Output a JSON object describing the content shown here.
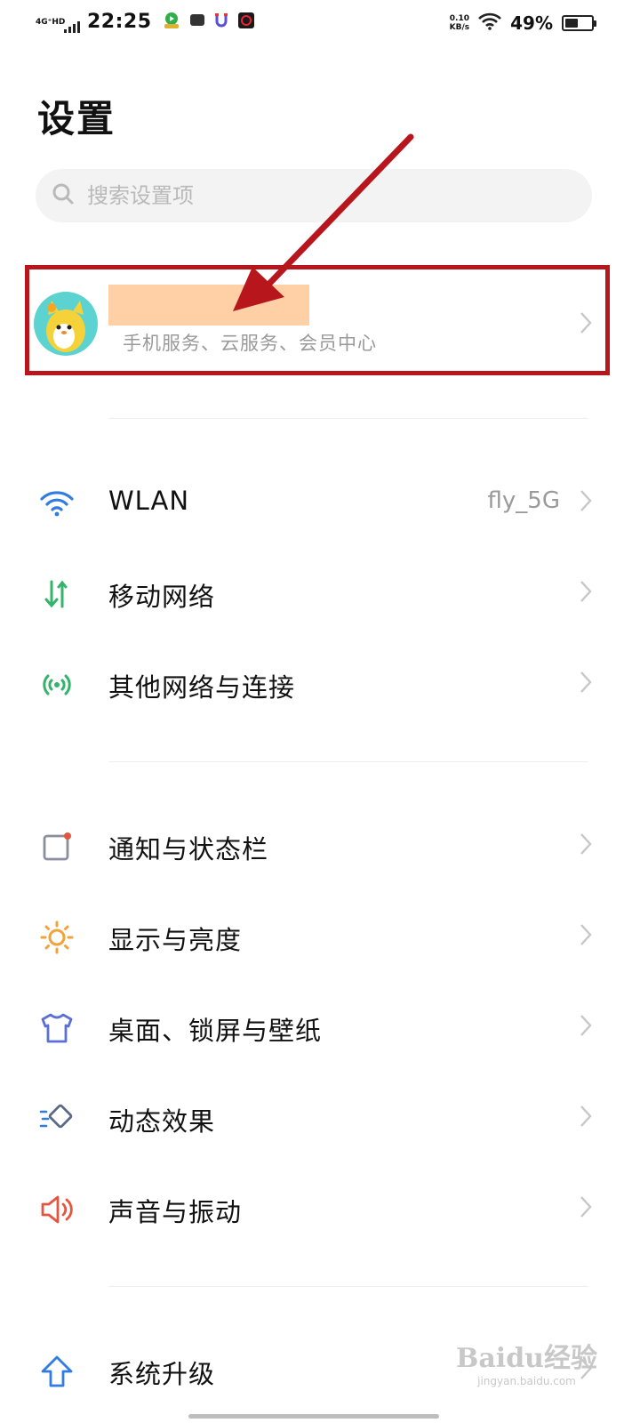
{
  "status_bar": {
    "network_type": "4G⁺HD",
    "time": "22:25",
    "speed_value": "0.10",
    "speed_unit": "KB/s",
    "battery_percent": "49%",
    "battery_level": 0.49
  },
  "page": {
    "title": "设置"
  },
  "search": {
    "placeholder": "搜索设置项"
  },
  "account": {
    "subtitle": "手机服务、云服务、会员中心"
  },
  "sections": [
    {
      "items": [
        {
          "label": "WLAN",
          "value": "fly_5G",
          "icon": "wifi-icon"
        },
        {
          "label": "移动网络",
          "icon": "mobile-network-icon"
        },
        {
          "label": "其他网络与连接",
          "icon": "connection-icon"
        }
      ]
    },
    {
      "items": [
        {
          "label": "通知与状态栏",
          "icon": "notification-icon"
        },
        {
          "label": "显示与亮度",
          "icon": "brightness-icon"
        },
        {
          "label": "桌面、锁屏与壁纸",
          "icon": "wallpaper-icon"
        },
        {
          "label": "动态效果",
          "icon": "animation-icon"
        },
        {
          "label": "声音与振动",
          "icon": "sound-icon"
        }
      ]
    },
    {
      "items": [
        {
          "label": "系统升级",
          "icon": "system-update-icon"
        }
      ]
    }
  ],
  "watermark": {
    "brand": "Baidu经验",
    "url": "jingyan.baidu.com"
  },
  "colors": {
    "annotation": "#b7161c",
    "wifi": "#2f7de1",
    "mobile": "#34b36a",
    "brightness": "#f2a23a",
    "wallpaper": "#5b6fd6",
    "sound": "#e2553f",
    "update": "#2f7de1"
  }
}
